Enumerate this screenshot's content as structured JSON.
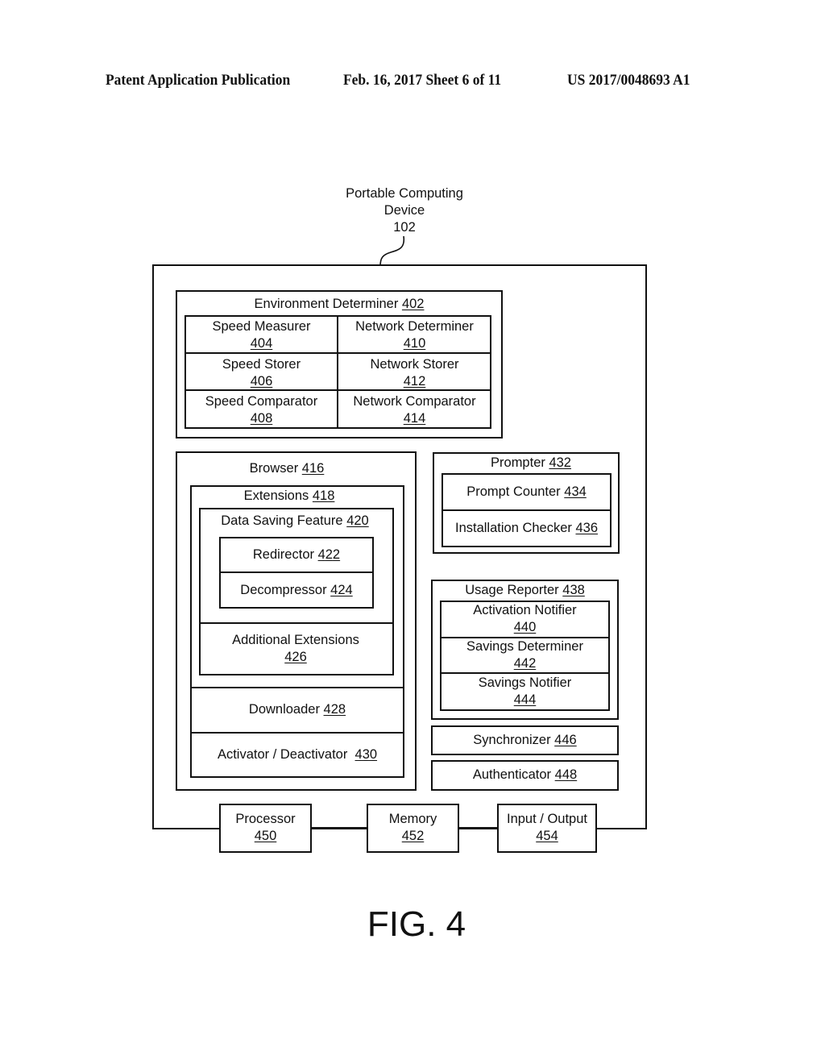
{
  "header": {
    "publication": "Patent Application Publication",
    "date_sheet": "Feb. 16, 2017  Sheet 6 of 11",
    "number": "US 2017/0048693 A1"
  },
  "device": {
    "line1": "Portable Computing",
    "line2": "Device",
    "num": "102"
  },
  "env": {
    "title": "Environment Determiner ",
    "num": "402",
    "cells": [
      {
        "name": "Speed Measurer",
        "num": "404"
      },
      {
        "name": "Network Determiner",
        "num": "410"
      },
      {
        "name": "Speed Storer",
        "num": "406"
      },
      {
        "name": "Network Storer",
        "num": "412"
      },
      {
        "name": "Speed Comparator",
        "num": "408"
      },
      {
        "name": "Network Comparator",
        "num": "414"
      }
    ]
  },
  "browser": {
    "title": "Browser ",
    "num": "416",
    "extensions": {
      "title": "Extensions ",
      "num": "418"
    },
    "dsf": {
      "title": "Data Saving Feature ",
      "num": "420"
    },
    "redirector": {
      "title": "Redirector ",
      "num": "422"
    },
    "decompressor": {
      "title": "Decompressor ",
      "num": "424"
    },
    "additional": {
      "title": "Additional Extensions",
      "num": "426"
    },
    "downloader": {
      "title": "Downloader ",
      "num": "428"
    },
    "activator": {
      "title": "Activator / Deactivator  ",
      "num": "430"
    }
  },
  "prompter": {
    "title": "Prompter ",
    "num": "432",
    "counter": {
      "title": "Prompt Counter ",
      "num": "434"
    },
    "checker": {
      "title": "Installation Checker ",
      "num": "436"
    }
  },
  "usage": {
    "title": "Usage Reporter ",
    "num": "438",
    "activation": {
      "title": "Activation Notifier",
      "num": "440"
    },
    "savings_det": {
      "title": "Savings Determiner",
      "num": "442"
    },
    "savings_not": {
      "title": "Savings Notifier",
      "num": "444"
    }
  },
  "synchronizer": {
    "title": "Synchronizer ",
    "num": "446"
  },
  "authenticator": {
    "title": "Authenticator ",
    "num": "448"
  },
  "hardware": {
    "processor": {
      "title": "Processor",
      "num": "450"
    },
    "memory": {
      "title": "Memory",
      "num": "452"
    },
    "io": {
      "title": "Input / Output",
      "num": "454"
    }
  },
  "figure": "FIG. 4"
}
